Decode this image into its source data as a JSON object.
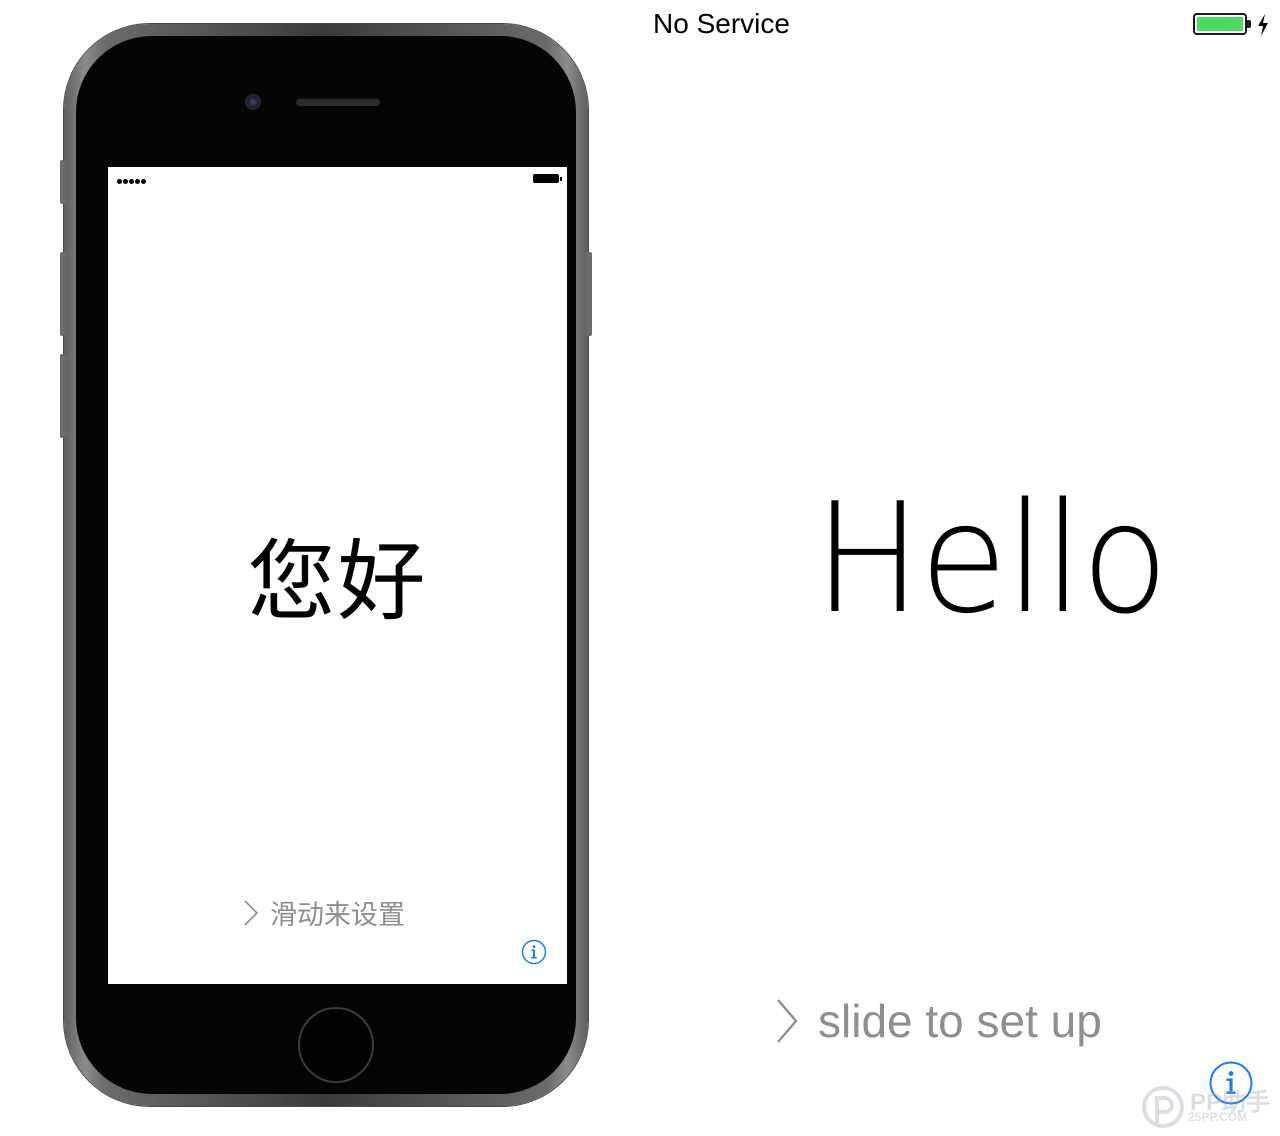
{
  "status_bar": {
    "carrier": "No Service",
    "battery_level": 1.0,
    "battery_color": "#4cd964",
    "charging": true
  },
  "phone_preview": {
    "greeting": "您好",
    "slide_hint": "滑动来设置",
    "info_icon": "info-circle-icon",
    "signal_dots": 5
  },
  "main": {
    "greeting": "Hello",
    "slide_hint": "slide to set up",
    "chevron_icon": "chevron-right-icon",
    "info_icon": "info-circle-icon",
    "accent_color": "#1a7cf5",
    "hint_color": "#8e8e93"
  },
  "watermark": {
    "logo_text": "PP助手",
    "site": "25PP.COM"
  }
}
